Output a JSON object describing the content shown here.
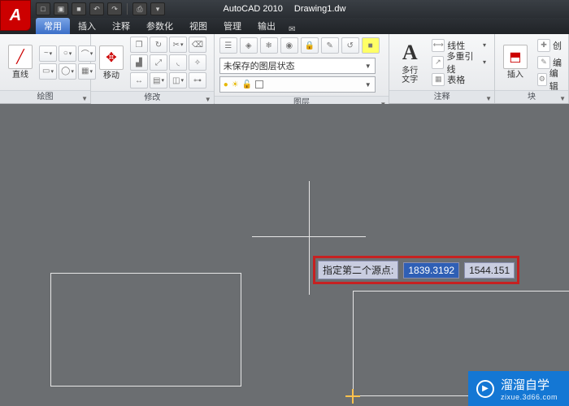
{
  "title": {
    "app": "AutoCAD 2010",
    "doc": "Drawing1.dw"
  },
  "logo_letter": "A",
  "qat": {
    "new": "□",
    "open": "▣",
    "save": "■",
    "undo": "↶",
    "redo": "↷",
    "print": "⎙",
    "drop": "▾"
  },
  "tabs": [
    "常用",
    "插入",
    "注释",
    "参数化",
    "视图",
    "管理",
    "输出"
  ],
  "output_icon": "✉",
  "panels": {
    "draw": {
      "title": "绘图",
      "line_label": "直线"
    },
    "modify": {
      "title": "修改",
      "move_label": "移动"
    },
    "layers": {
      "title": "图层",
      "combo": "未保存的图层状态"
    },
    "annot": {
      "title": "注释",
      "mtext_label": "多行\n文字",
      "A": "A",
      "linetype": "线性",
      "mleader": "多重引线",
      "table": "表格"
    },
    "block": {
      "title": "块",
      "insert_label": "插入",
      "create": "创",
      "edit": "编",
      "editattr": "编辑"
    }
  },
  "canvas": {
    "prompt": "指定第二个源点:",
    "coord_x": "1839.3192",
    "coord_y": "1544.151"
  },
  "watermark": {
    "main": "溜溜自学",
    "sub": "zixue.3d66.com"
  }
}
